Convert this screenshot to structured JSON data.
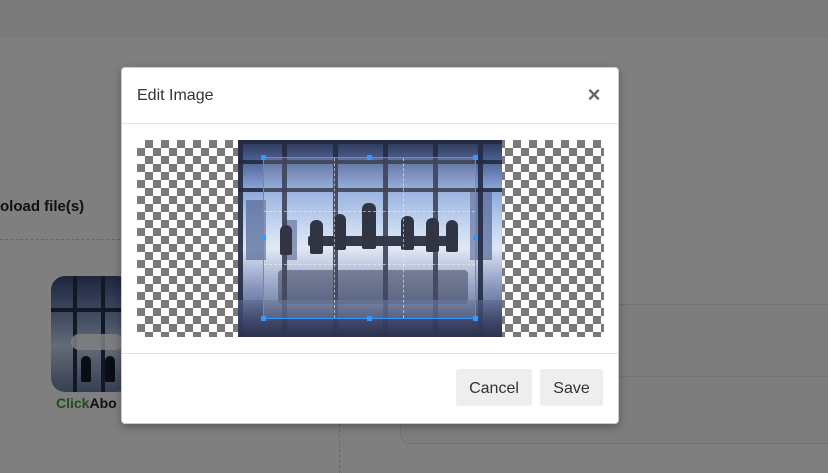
{
  "background": {
    "upload_label": "oload file(s)",
    "thumb_caption_accent": "Click",
    "thumb_caption_rest": "Abo"
  },
  "modal": {
    "title": "Edit Image",
    "close_glyph": "×",
    "cancel_label": "Cancel",
    "save_label": "Save"
  },
  "colors": {
    "crop_outline": "#3399ff",
    "backdrop": "rgba(0,0,0,0.5)",
    "accent_green": "#3c9a3c"
  }
}
